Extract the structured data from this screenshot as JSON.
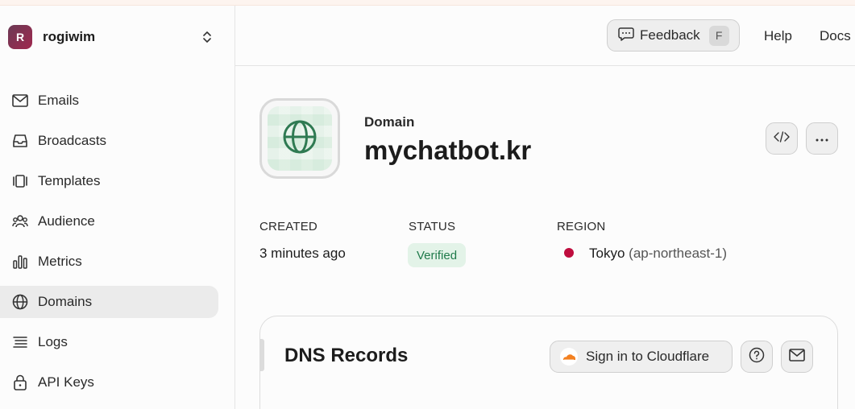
{
  "team": {
    "initial": "R",
    "name": "rogiwim"
  },
  "sidebar": {
    "items": [
      {
        "label": "Emails",
        "icon": "mail-icon"
      },
      {
        "label": "Broadcasts",
        "icon": "inbox-icon"
      },
      {
        "label": "Templates",
        "icon": "templates-icon"
      },
      {
        "label": "Audience",
        "icon": "users-icon"
      },
      {
        "label": "Metrics",
        "icon": "bar-chart-icon"
      },
      {
        "label": "Domains",
        "icon": "globe-icon",
        "active": true
      },
      {
        "label": "Logs",
        "icon": "logs-icon"
      },
      {
        "label": "API Keys",
        "icon": "lock-icon"
      }
    ]
  },
  "header": {
    "feedback_label": "Feedback",
    "feedback_shortcut": "F",
    "help_label": "Help",
    "docs_label": "Docs"
  },
  "domain": {
    "kicker": "Domain",
    "name": "mychatbot.kr",
    "created_label": "CREATED",
    "created_value": "3 minutes ago",
    "status_label": "STATUS",
    "status_value": "Verified",
    "region_label": "REGION",
    "region_city": "Tokyo",
    "region_code": "(ap-northeast-1)"
  },
  "dns": {
    "title": "DNS Records",
    "cloudflare_label": "Sign in to Cloudflare"
  },
  "colors": {
    "accent_green": "#2f7a52",
    "status_bg": "#e3f3e8",
    "status_text": "#1f7a4a",
    "region_dot": "#bf0d3e",
    "cloudflare_orange": "#f38020"
  }
}
